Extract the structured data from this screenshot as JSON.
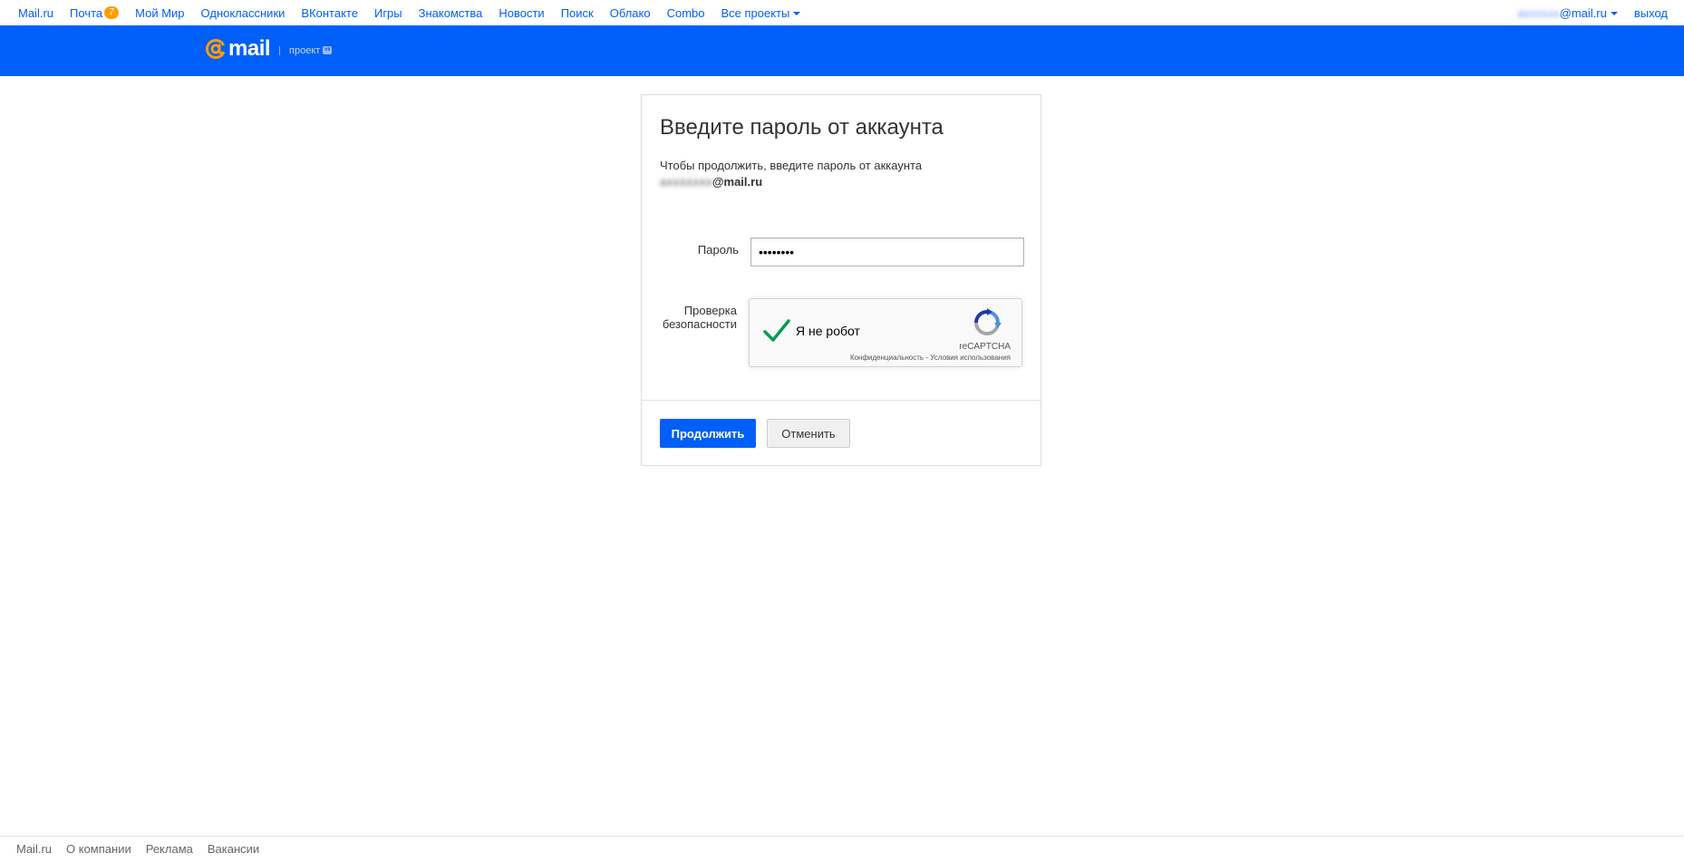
{
  "portal": {
    "links": [
      {
        "label": "Mail.ru"
      },
      {
        "label": "Почта",
        "badge": "7"
      },
      {
        "label": "Мой Мир"
      },
      {
        "label": "Одноклассники"
      },
      {
        "label": "ВКонтакте"
      },
      {
        "label": "Игры"
      },
      {
        "label": "Знакомства"
      },
      {
        "label": "Новости"
      },
      {
        "label": "Поиск"
      },
      {
        "label": "Облако"
      },
      {
        "label": "Combo"
      }
    ],
    "all_projects": "Все проекты",
    "user_blurred": "axxxxxx",
    "user_domain": "@mail.ru",
    "logout": "выход"
  },
  "header": {
    "logo_text": "mail",
    "project_label": "проект",
    "vk_label": "vk"
  },
  "form": {
    "title": "Введите пароль от аккаунта",
    "description": "Чтобы продолжить, введите пароль от аккаунта",
    "email_blurred": "axxxxxxx",
    "email_domain": "@mail.ru",
    "password_label": "Пароль",
    "password_value": "••••••••",
    "security_label_line1": "Проверка",
    "security_label_line2": "безопасности",
    "captcha_label": "Я не робот",
    "recaptcha_name": "reCAPTCHA",
    "recaptcha_privacy": "Конфиденциальность",
    "recaptcha_sep": " - ",
    "recaptcha_terms": "Условия использования",
    "continue_button": "Продолжить",
    "cancel_button": "Отменить"
  },
  "footer": {
    "links": [
      "Mail.ru",
      "О компании",
      "Реклама",
      "Вакансии"
    ]
  },
  "colors": {
    "brand_blue": "#005ff9",
    "badge_orange": "#ff9e00",
    "logo_orange": "#ff9e00",
    "check_green": "#009e55"
  }
}
